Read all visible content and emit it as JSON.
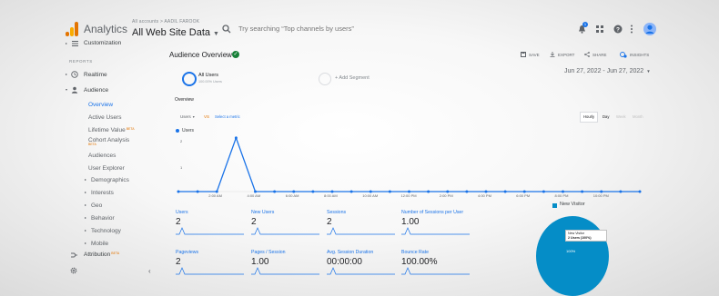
{
  "header": {
    "app_name": "Analytics",
    "breadcrumb": "All accounts > AADIL FAROOK",
    "view_name": "All Web Site Data",
    "search_placeholder": "Try searching “Top channels by users”",
    "notification_count": "1"
  },
  "sidebar": {
    "customization": "Customization",
    "section_label": "REPORTS",
    "realtime": "Realtime",
    "audience": "Audience",
    "items": [
      {
        "label": "Overview",
        "active": true
      },
      {
        "label": "Active Users"
      },
      {
        "label": "Lifetime Value",
        "badge": "BETA"
      },
      {
        "label": "Cohort Analysis",
        "badge": "BETA"
      },
      {
        "label": "Audiences"
      },
      {
        "label": "User Explorer"
      },
      {
        "label": "Demographics",
        "expandable": true
      },
      {
        "label": "Interests",
        "expandable": true
      },
      {
        "label": "Geo",
        "expandable": true
      },
      {
        "label": "Behavior",
        "expandable": true
      },
      {
        "label": "Technology",
        "expandable": true
      },
      {
        "label": "Mobile",
        "expandable": true
      }
    ],
    "attribution": "Attribution",
    "attribution_badge": "BETA"
  },
  "report": {
    "title": "Audience Overview",
    "actions": [
      "SAVE",
      "EXPORT",
      "SHARE",
      "INSIGHTS"
    ],
    "date_range": "Jun 27, 2022 - Jun 27, 2022",
    "segment_name": "All Users",
    "segment_sub": "100.00% Users",
    "add_segment": "+ Add Segment",
    "overview_label": "Overview",
    "metric_select": "Users",
    "vs": "VS",
    "select_metric": "Select a metric",
    "periods": [
      {
        "label": "Hourly",
        "active": true
      },
      {
        "label": "Day",
        "active": false
      },
      {
        "label": "Week",
        "active": false
      },
      {
        "label": "Month",
        "active": false
      }
    ]
  },
  "chart_data": {
    "type": "line",
    "legend": [
      "Users"
    ],
    "y_ticks": [
      "2",
      "1"
    ],
    "x_tick_labels": [
      "2:00 AM",
      "4:00 AM",
      "6:00 AM",
      "8:00 AM",
      "10:00 AM",
      "12:00 PM",
      "2:00 PM",
      "4:00 PM",
      "6:00 PM",
      "8:00 PM",
      "10:00 PM"
    ],
    "series": [
      {
        "name": "Users",
        "color": "#1a73e8",
        "values": [
          0,
          0,
          0,
          2,
          0,
          0,
          0,
          0,
          0,
          0,
          0,
          0,
          0,
          0,
          0,
          0,
          0,
          0,
          0,
          0,
          0,
          0,
          0,
          0,
          0
        ]
      }
    ],
    "ylim": [
      0,
      2.4
    ],
    "grid": false
  },
  "metrics": [
    {
      "label": "Users",
      "value": "2"
    },
    {
      "label": "New Users",
      "value": "2"
    },
    {
      "label": "Sessions",
      "value": "2"
    },
    {
      "label": "Number of Sessions per User",
      "value": "1.00"
    },
    {
      "label": "Pageviews",
      "value": "2"
    },
    {
      "label": "Pages / Session",
      "value": "1.00"
    },
    {
      "label": "Avg. Session Duration",
      "value": "00:00:00"
    },
    {
      "label": "Bounce Rate",
      "value": "100.00%"
    }
  ],
  "pie": {
    "legend": "New Visitor",
    "color": "#058dc7",
    "tooltip_title": "New Visitor",
    "tooltip_value": "2 Users (100%)",
    "slice_label": "100%"
  }
}
